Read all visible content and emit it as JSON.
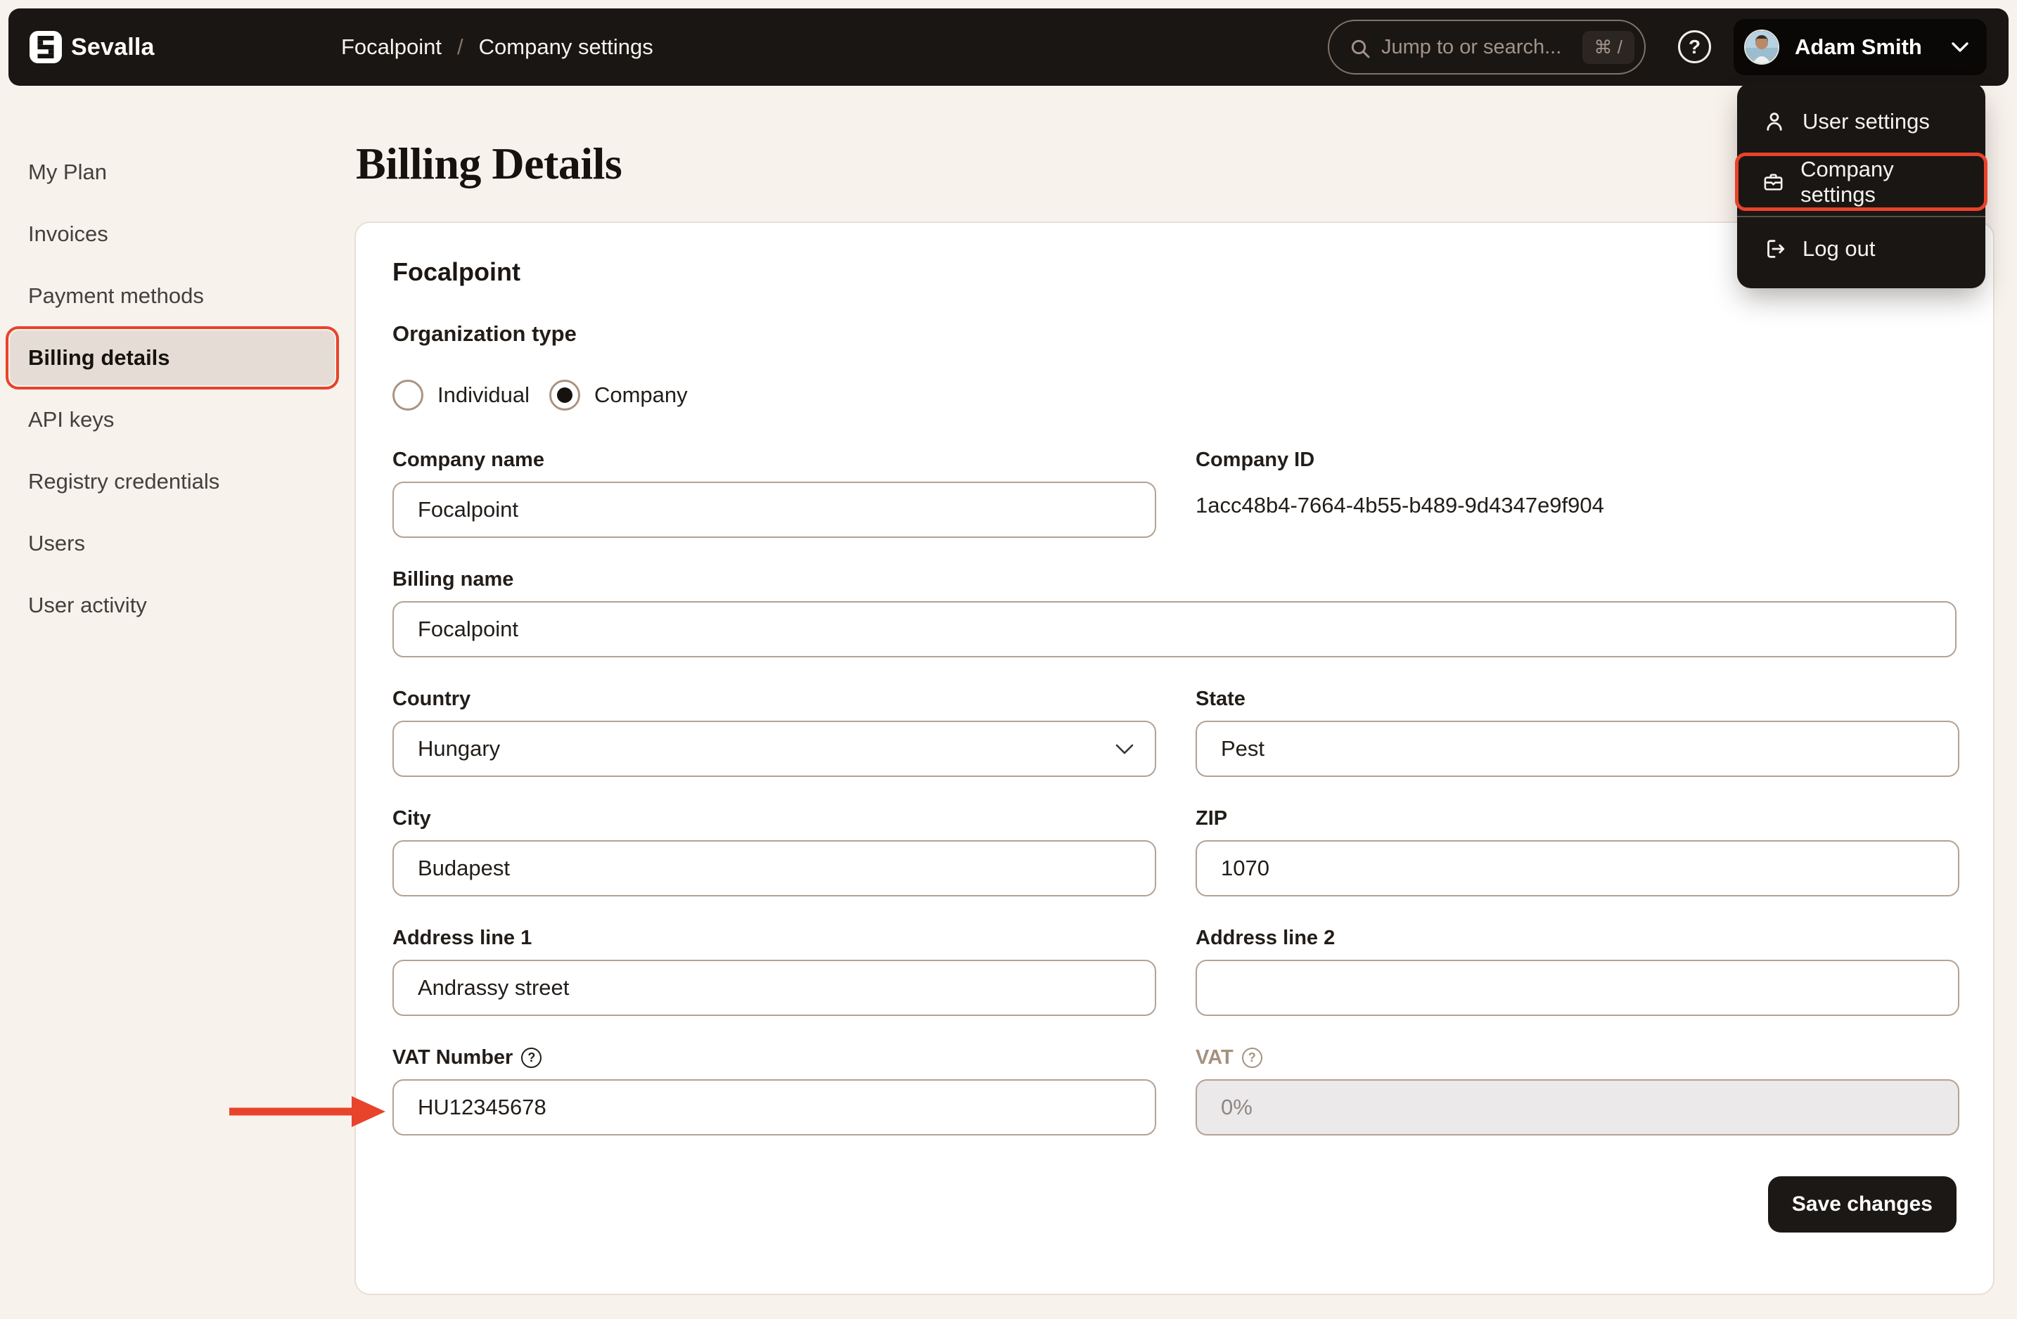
{
  "topbar": {
    "logo_text": "Sevalla",
    "breadcrumb": {
      "project": "Focalpoint",
      "separator": "/",
      "current": "Company settings"
    },
    "search": {
      "placeholder": "Jump to or search...",
      "shortcut": "⌘ /"
    },
    "user_name": "Adam Smith"
  },
  "user_menu": {
    "items": [
      {
        "label": "User settings"
      },
      {
        "label": "Company settings"
      },
      {
        "label": "Log out"
      }
    ]
  },
  "sidebar": {
    "items": [
      {
        "label": "My Plan"
      },
      {
        "label": "Invoices"
      },
      {
        "label": "Payment methods"
      },
      {
        "label": "Billing details"
      },
      {
        "label": "API keys"
      },
      {
        "label": "Registry credentials"
      },
      {
        "label": "Users"
      },
      {
        "label": "User activity"
      }
    ]
  },
  "page": {
    "title": "Billing Details"
  },
  "billing_card": {
    "company_title": "Focalpoint",
    "organization_type": {
      "label": "Organization type",
      "options": [
        {
          "label": "Individual",
          "selected": false
        },
        {
          "label": "Company",
          "selected": true
        }
      ]
    },
    "fields": {
      "company_name": {
        "label": "Company name",
        "value": "Focalpoint"
      },
      "company_id": {
        "label": "Company ID",
        "value": "1acc48b4-7664-4b55-b489-9d4347e9f904"
      },
      "billing_name": {
        "label": "Billing name",
        "value": "Focalpoint"
      },
      "country": {
        "label": "Country",
        "value": "Hungary"
      },
      "state": {
        "label": "State",
        "value": "Pest"
      },
      "city": {
        "label": "City",
        "value": "Budapest"
      },
      "zip": {
        "label": "ZIP",
        "value": "1070"
      },
      "address_line_1": {
        "label": "Address line 1",
        "value": "Andrassy street"
      },
      "address_line_2": {
        "label": "Address line 2",
        "value": ""
      },
      "vat_number": {
        "label": "VAT Number",
        "value": "HU12345678"
      },
      "vat": {
        "label": "VAT",
        "value": "0%"
      }
    },
    "save_label": "Save changes"
  },
  "icons": {
    "help_glyph": "?"
  },
  "annotations": {
    "highlight_color": "#e8432b"
  }
}
